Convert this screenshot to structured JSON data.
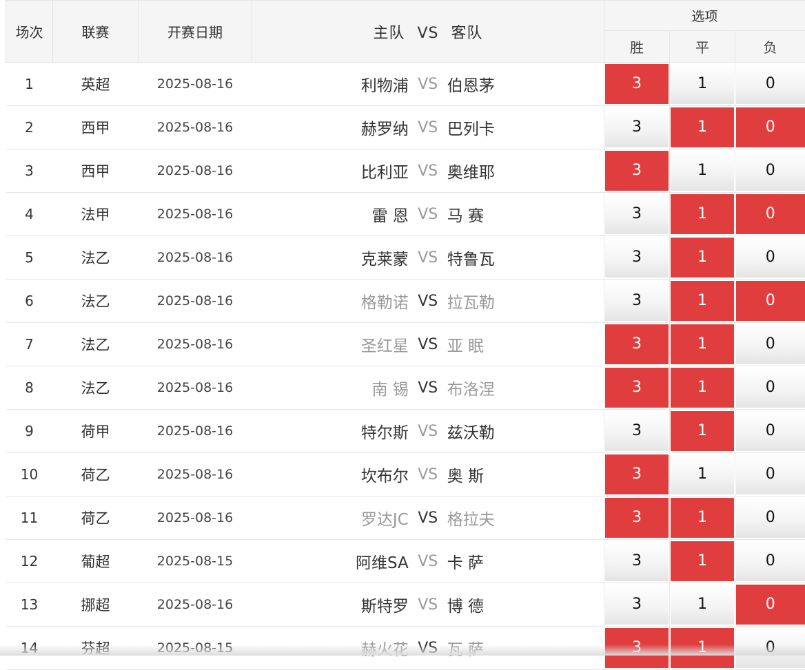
{
  "header": {
    "seq": "场次",
    "league": "联赛",
    "date": "开赛日期",
    "home": "主队",
    "vs": "VS",
    "away": "客队",
    "options": "选项",
    "win": "胜",
    "draw": "平",
    "lose": "负"
  },
  "colors": {
    "selected_bg": "#e03e3e",
    "selected_text": "#ffffff",
    "dim_team": "#999999"
  },
  "rows": [
    {
      "seq": "1",
      "league": "英超",
      "date": "2025-08-16",
      "home": "利物浦",
      "away": "伯恩茅",
      "dim": false,
      "win": "3",
      "draw": "1",
      "lose": "0",
      "sel": [
        true,
        false,
        false
      ]
    },
    {
      "seq": "2",
      "league": "西甲",
      "date": "2025-08-16",
      "home": "赫罗纳",
      "away": "巴列卡",
      "dim": false,
      "win": "3",
      "draw": "1",
      "lose": "0",
      "sel": [
        false,
        true,
        true
      ]
    },
    {
      "seq": "3",
      "league": "西甲",
      "date": "2025-08-16",
      "home": "比利亚",
      "away": "奥维耶",
      "dim": false,
      "win": "3",
      "draw": "1",
      "lose": "0",
      "sel": [
        true,
        false,
        false
      ]
    },
    {
      "seq": "4",
      "league": "法甲",
      "date": "2025-08-16",
      "home": "雷 恩",
      "away": "马 赛",
      "dim": false,
      "win": "3",
      "draw": "1",
      "lose": "0",
      "sel": [
        false,
        true,
        true
      ]
    },
    {
      "seq": "5",
      "league": "法乙",
      "date": "2025-08-16",
      "home": "克莱蒙",
      "away": "特鲁瓦",
      "dim": false,
      "win": "3",
      "draw": "1",
      "lose": "0",
      "sel": [
        false,
        true,
        false
      ]
    },
    {
      "seq": "6",
      "league": "法乙",
      "date": "2025-08-16",
      "home": "格勒诺",
      "away": "拉瓦勒",
      "dim": true,
      "win": "3",
      "draw": "1",
      "lose": "0",
      "sel": [
        false,
        true,
        true
      ]
    },
    {
      "seq": "7",
      "league": "法乙",
      "date": "2025-08-16",
      "home": "圣红星",
      "away": "亚 眠",
      "dim": true,
      "win": "3",
      "draw": "1",
      "lose": "0",
      "sel": [
        true,
        true,
        false
      ]
    },
    {
      "seq": "8",
      "league": "法乙",
      "date": "2025-08-16",
      "home": "南 锡",
      "away": "布洛涅",
      "dim": true,
      "win": "3",
      "draw": "1",
      "lose": "0",
      "sel": [
        true,
        true,
        false
      ]
    },
    {
      "seq": "9",
      "league": "荷甲",
      "date": "2025-08-16",
      "home": "特尔斯",
      "away": "兹沃勒",
      "dim": false,
      "win": "3",
      "draw": "1",
      "lose": "0",
      "sel": [
        false,
        true,
        false
      ]
    },
    {
      "seq": "10",
      "league": "荷乙",
      "date": "2025-08-16",
      "home": "坎布尔",
      "away": "奥 斯",
      "dim": false,
      "win": "3",
      "draw": "1",
      "lose": "0",
      "sel": [
        true,
        false,
        false
      ]
    },
    {
      "seq": "11",
      "league": "荷乙",
      "date": "2025-08-16",
      "home": "罗达JC",
      "away": "格拉夫",
      "dim": true,
      "win": "3",
      "draw": "1",
      "lose": "0",
      "sel": [
        true,
        true,
        false
      ]
    },
    {
      "seq": "12",
      "league": "葡超",
      "date": "2025-08-15",
      "home": "阿维SA",
      "away": "卡 萨",
      "dim": false,
      "win": "3",
      "draw": "1",
      "lose": "0",
      "sel": [
        false,
        true,
        false
      ]
    },
    {
      "seq": "13",
      "league": "挪超",
      "date": "2025-08-16",
      "home": "斯特罗",
      "away": "博 德",
      "dim": false,
      "win": "3",
      "draw": "1",
      "lose": "0",
      "sel": [
        false,
        false,
        true
      ]
    },
    {
      "seq": "14",
      "league": "芬超",
      "date": "2025-08-15",
      "home": "赫火花",
      "away": "瓦 萨",
      "dim": true,
      "win": "3",
      "draw": "1",
      "lose": "0",
      "sel": [
        true,
        true,
        false
      ]
    }
  ]
}
